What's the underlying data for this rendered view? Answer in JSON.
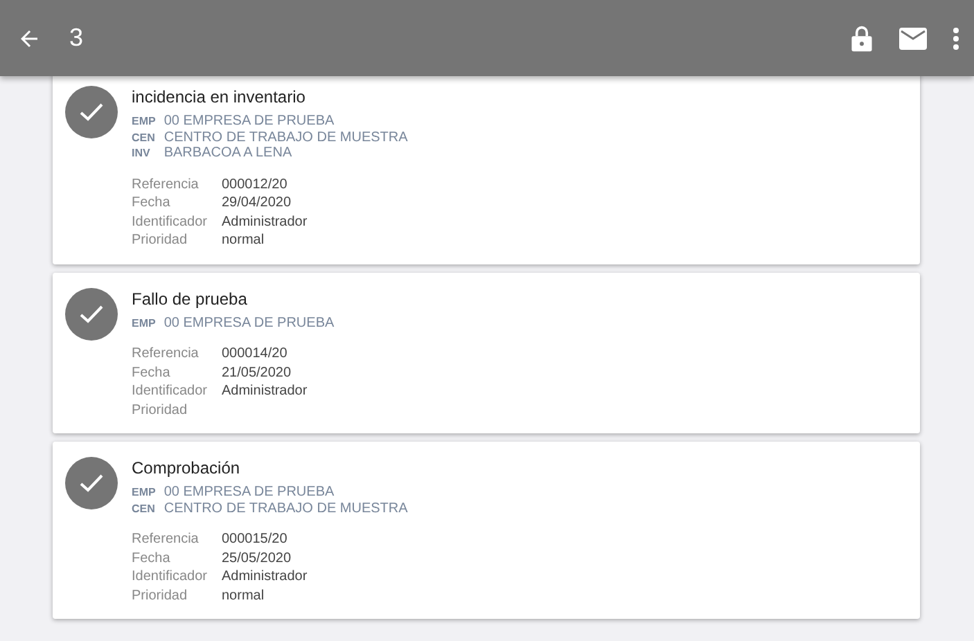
{
  "app_bar": {
    "title": "3"
  },
  "cards": [
    {
      "title": "incidencia en inventario",
      "codes": [
        {
          "code": "EMP",
          "text": "00 EMPRESA DE PRUEBA"
        },
        {
          "code": "CEN",
          "text": "CENTRO DE TRABAJO DE MUESTRA"
        },
        {
          "code": "INV",
          "text": "BARBACOA A LENA"
        }
      ],
      "fields": [
        {
          "label": "Referencia",
          "value": "000012/20"
        },
        {
          "label": "Fecha",
          "value": "29/04/2020"
        },
        {
          "label": "Identificador",
          "value": "Administrador"
        },
        {
          "label": "Prioridad",
          "value": "normal"
        }
      ]
    },
    {
      "title": "Fallo de prueba",
      "codes": [
        {
          "code": "EMP",
          "text": "00 EMPRESA DE PRUEBA"
        }
      ],
      "fields": [
        {
          "label": "Referencia",
          "value": "000014/20"
        },
        {
          "label": "Fecha",
          "value": "21/05/2020"
        },
        {
          "label": "Identificador",
          "value": "Administrador"
        },
        {
          "label": "Prioridad"
        }
      ]
    },
    {
      "title": "Comprobación",
      "codes": [
        {
          "code": "EMP",
          "text": "00 EMPRESA DE PRUEBA"
        },
        {
          "code": "CEN",
          "text": "CENTRO DE TRABAJO DE MUESTRA"
        }
      ],
      "fields": [
        {
          "label": "Referencia",
          "value": "000015/20"
        },
        {
          "label": "Fecha",
          "value": "25/05/2020"
        },
        {
          "label": "Identificador",
          "value": "Administrador"
        },
        {
          "label": "Prioridad",
          "value": "normal"
        }
      ]
    }
  ]
}
